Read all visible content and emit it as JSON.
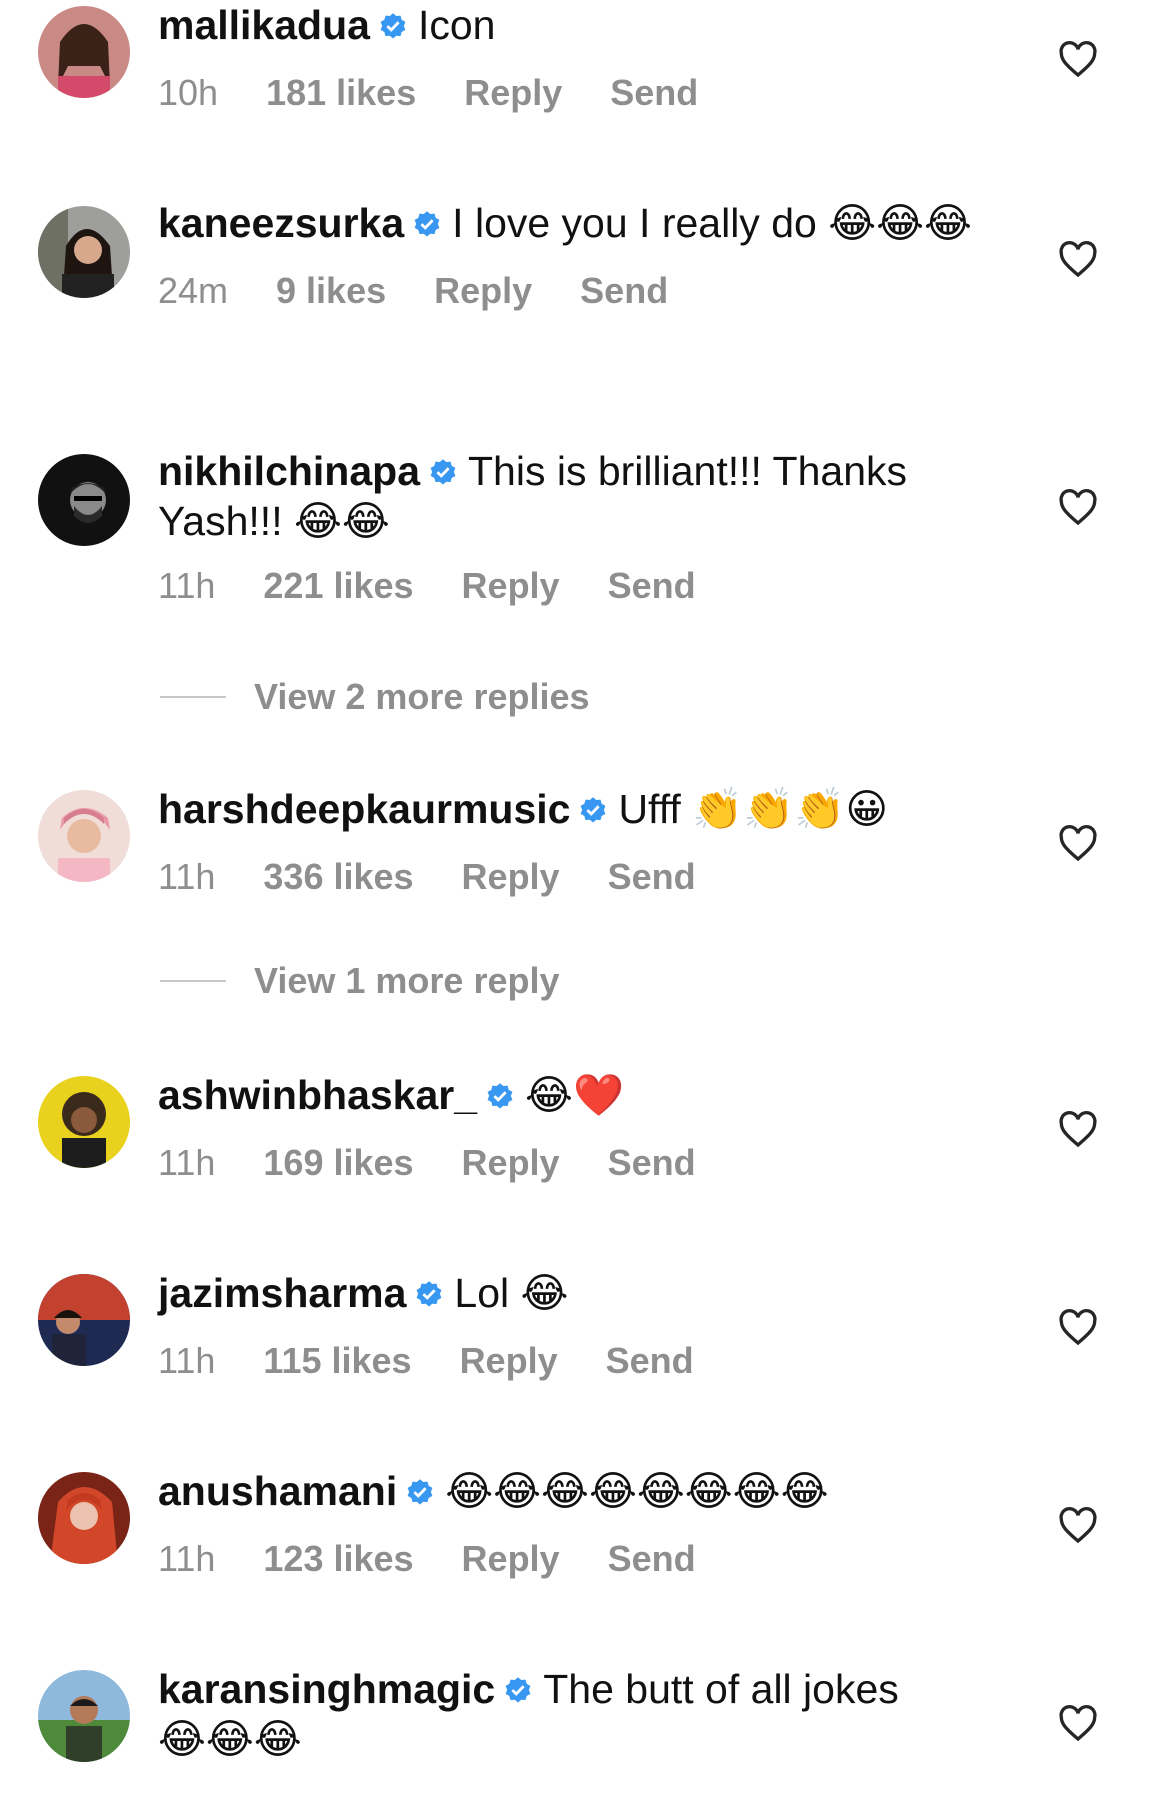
{
  "verified_icon": "verified-badge-icon",
  "heart_icon": "heart-outline-icon",
  "comments": [
    {
      "username": "mallikadua",
      "text": "Icon",
      "emojis": "",
      "time": "10h",
      "likes": "181 likes",
      "reply": "Reply",
      "send": "Send"
    },
    {
      "username": "kaneezsurka",
      "text": "I love you I really do",
      "emojis": "😂😂😂",
      "time": "24m",
      "likes": "9 likes",
      "reply": "Reply",
      "send": "Send"
    },
    {
      "username": "nikhilchinapa",
      "text": "This is brilliant!!! Thanks Yash!!!",
      "emojis": "😂😂",
      "time": "11h",
      "likes": "221 likes",
      "reply": "Reply",
      "send": "Send",
      "view_replies": "View 2 more replies"
    },
    {
      "username": "harshdeepkaurmusic",
      "text": "Ufff",
      "emojis": "👏👏👏😀",
      "time": "11h",
      "likes": "336 likes",
      "reply": "Reply",
      "send": "Send",
      "view_replies": "View 1 more reply"
    },
    {
      "username": "ashwinbhaskar_",
      "text": "",
      "emojis": "😂❤️",
      "time": "11h",
      "likes": "169 likes",
      "reply": "Reply",
      "send": "Send"
    },
    {
      "username": "jazimsharma",
      "text": "Lol",
      "emojis": "😂",
      "time": "11h",
      "likes": "115 likes",
      "reply": "Reply",
      "send": "Send"
    },
    {
      "username": "anushamani",
      "text": "",
      "emojis": "😂😂😂😂😂😂😂😂",
      "time": "11h",
      "likes": "123 likes",
      "reply": "Reply",
      "send": "Send"
    },
    {
      "username": "karansinghmagic",
      "text": "The butt of all jokes",
      "emojis": "😂😂😂",
      "time": "",
      "likes": "",
      "reply": "",
      "send": ""
    }
  ],
  "colors": {
    "meta": "#8e8e8e",
    "verified": "#3897f0",
    "divider": "#c7c7c7"
  }
}
